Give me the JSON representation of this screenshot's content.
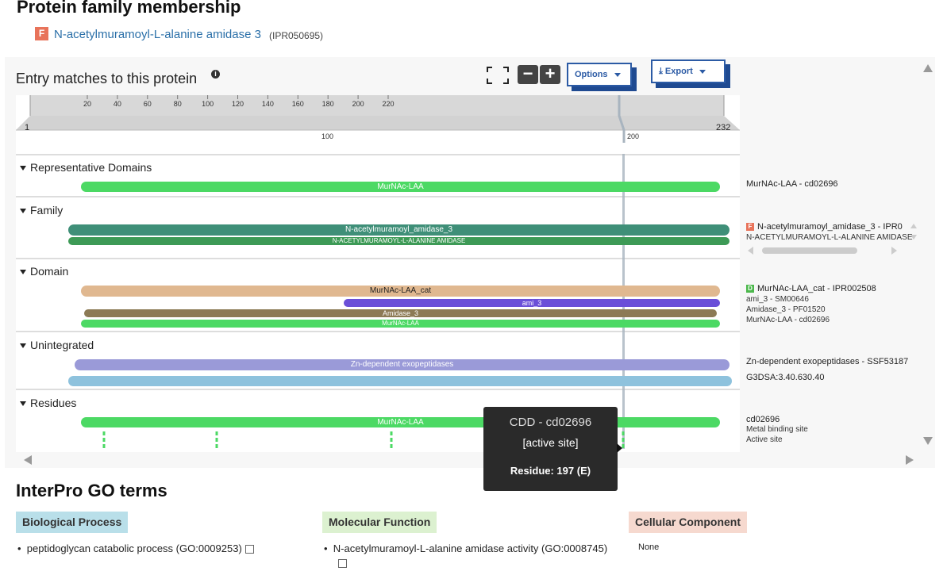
{
  "page_title": "Protein family membership",
  "family": {
    "badge": "F",
    "name": "N-acetylmuramoyl-L-alanine amidase 3",
    "accession": "(IPR050695)"
  },
  "entry_matches": {
    "title": "Entry matches to this protein",
    "info_icon": "i"
  },
  "toolbar": {
    "options_label": "Options",
    "export_label": "Export",
    "export_icon": "download-icon"
  },
  "ruler": {
    "ticks": [
      "20",
      "40",
      "60",
      "80",
      "100",
      "120",
      "140",
      "160",
      "180",
      "200",
      "220"
    ],
    "start": "1",
    "end": "232",
    "lower_ticks": [
      "100",
      "200"
    ]
  },
  "sections": {
    "representative": {
      "label": "Representative Domains",
      "bar": "MurNAc-LAA",
      "right_label": "MurNAc-LAA - cd02696"
    },
    "family": {
      "label": "Family",
      "bar1": "N-acetylmuramoyl_amidase_3",
      "bar2": "N-ACETYLMURAMOYL-L-ALANINE AMIDASE",
      "right_badge": "F",
      "right_label1": "N-acetylmuramoyl_amidase_3 - IPR0",
      "right_label2": "N-ACETYLMURAMOYL-L-ALANINE AMIDASE"
    },
    "domain": {
      "label": "Domain",
      "bar1": "MurNAc-LAA_cat",
      "bar2": "ami_3",
      "bar3": "Amidase_3",
      "bar4": "MurNAc-LAA",
      "right_badge": "D",
      "right_label1": "MurNAc-LAA_cat - IPR002508",
      "right_label2": "ami_3 - SM00646",
      "right_label3": "Amidase_3 - PF01520",
      "right_label4": "MurNAc-LAA - cd02696"
    },
    "unintegrated": {
      "label": "Unintegrated",
      "bar1": "Zn-dependent exopeptidases",
      "right_label1": "Zn-dependent exopeptidases - SSF53187",
      "right_label2": "G3DSA:3.40.630.40"
    },
    "residues": {
      "label": "Residues",
      "bar": "MurNAc-LAA",
      "right_label1": "cd02696",
      "right_label2": "Metal binding site",
      "right_label3": "Active site"
    }
  },
  "tooltip": {
    "title": "CDD - cd02696",
    "subtitle": "[active site]",
    "residue_label": "Residue: 197 (E)"
  },
  "go": {
    "title": "InterPro GO terms",
    "biological_process": {
      "label": "Biological Process",
      "color": "#b9dfe9",
      "item": "peptidoglycan catabolic process (GO:0009253)"
    },
    "molecular_function": {
      "label": "Molecular Function",
      "color": "#dcf1d0",
      "item": "N-acetylmuramoyl-L-alanine amidase activity (GO:0008745)"
    },
    "cellular_component": {
      "label": "Cellular Component",
      "color": "#f6d9cf",
      "item": "None"
    }
  },
  "colors": {
    "green": "#4cd964",
    "teal_family": "#3f8f78",
    "domain_tan": "#e0b890",
    "purple": "#6a4fd8",
    "olive": "#8c7a55",
    "lavender": "#9a9ad8",
    "lightblue": "#8ec2dd",
    "button_blue": "#2c5ba5",
    "family_badge": "#e8735a",
    "domain_badge": "#4cb84c"
  }
}
